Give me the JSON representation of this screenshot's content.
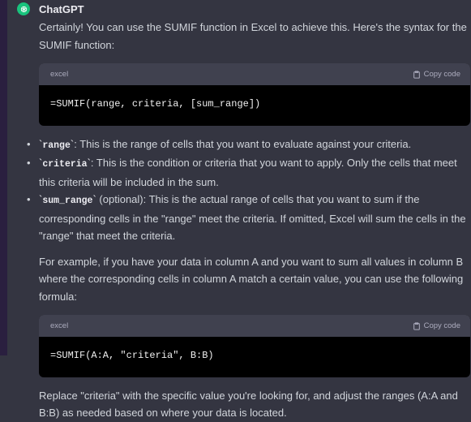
{
  "author": "ChatGPT",
  "intro": "Certainly! You can use the SUMIF function in Excel to achieve this. Here's the syntax for the SUMIF function:",
  "code_blocks": [
    {
      "language": "excel",
      "copy_label": "Copy code",
      "code": "=SUMIF(range, criteria, [sum_range])"
    },
    {
      "language": "excel",
      "copy_label": "Copy code",
      "code": "=SUMIF(A:A, \"criteria\", B:B)"
    }
  ],
  "bullets": [
    {
      "term": "range",
      "text": ": This is the range of cells that you want to evaluate against your criteria."
    },
    {
      "term": "criteria",
      "text": ": This is the condition or criteria that you want to apply. Only the cells that meet this criteria will be included in the sum."
    },
    {
      "term": "sum_range",
      "text": " (optional): This is the actual range of cells that you want to sum if the corresponding cells in the \"range\" meet the criteria. If omitted, Excel will sum the cells in the \"range\" that meet the criteria."
    }
  ],
  "example_paragraph": "For example, if you have your data in column A and you want to sum all values in column B where the corresponding cells in column A match a certain value, you can use the following formula:",
  "closing_paragraph": "Replace \"criteria\" with the specific value you're looking for, and adjust the ranges (A:A and B:B) as needed based on where your data is located.",
  "colors": {
    "background": "#343541",
    "avatar": "#19c37d",
    "code_bg": "#000000",
    "code_header": "#40414f"
  },
  "icons": {
    "avatar": "openai-logo-icon",
    "copy": "clipboard-icon"
  }
}
